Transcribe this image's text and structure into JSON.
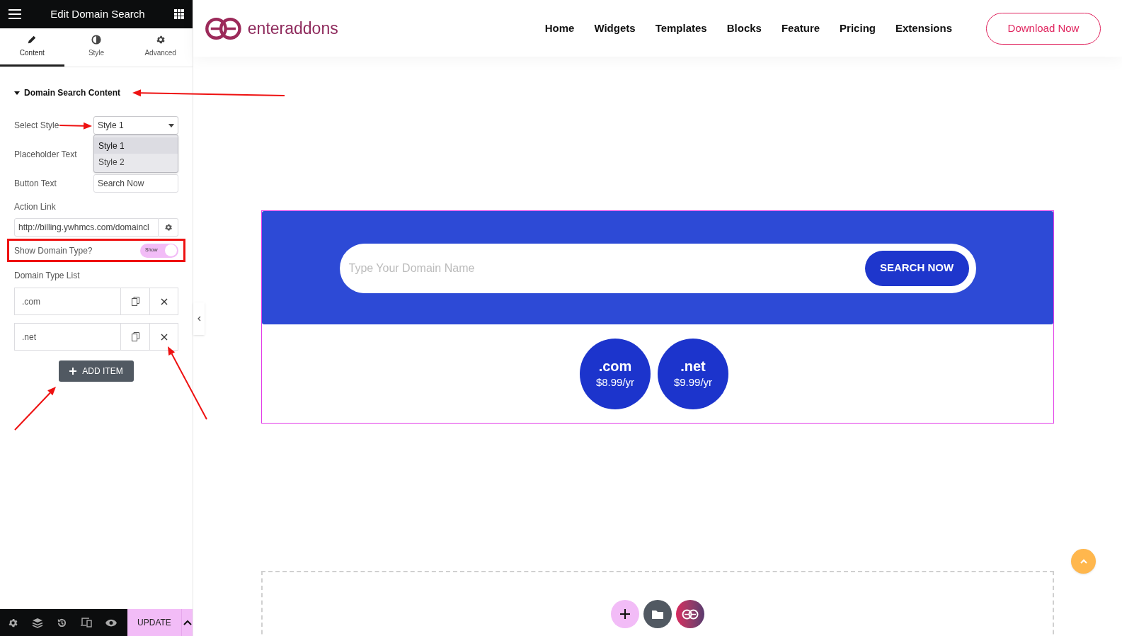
{
  "panel": {
    "title": "Edit Domain Search",
    "tabs": [
      {
        "label": "Content",
        "selected": true
      },
      {
        "label": "Style",
        "selected": false
      },
      {
        "label": "Advanced",
        "selected": false
      }
    ],
    "section": {
      "title": "Domain Search Content",
      "expanded": true
    },
    "select_style": {
      "label": "Select Style",
      "value": "Style 1",
      "options": [
        {
          "label": "Style 1",
          "selected": true
        },
        {
          "label": "Style 2",
          "selected": false
        }
      ]
    },
    "placeholder_text": {
      "label": "Placeholder Text"
    },
    "button_text": {
      "label": "Button Text",
      "value": "Search Now"
    },
    "action_link": {
      "label": "Action Link",
      "value": "http://billing.ywhmcs.com/domaincl"
    },
    "show_domain_type": {
      "label": "Show Domain Type?",
      "on": true,
      "toggle_label": "Show"
    },
    "domain_type_list": {
      "label": "Domain Type List",
      "items": [
        ".com",
        ".net"
      ],
      "add_button": "ADD ITEM"
    },
    "update_button": "UPDATE"
  },
  "site": {
    "logo": "enteraddons",
    "nav": [
      "Home",
      "Widgets",
      "Templates",
      "Blocks",
      "Feature",
      "Pricing",
      "Extensions"
    ],
    "cta": "Download Now",
    "search": {
      "placeholder": "Type Your Domain Name",
      "button": "SEARCH NOW"
    },
    "domains": [
      {
        "name": ".com",
        "price": "$8.99/yr"
      },
      {
        "name": ".net",
        "price": "$9.99/yr"
      }
    ]
  }
}
